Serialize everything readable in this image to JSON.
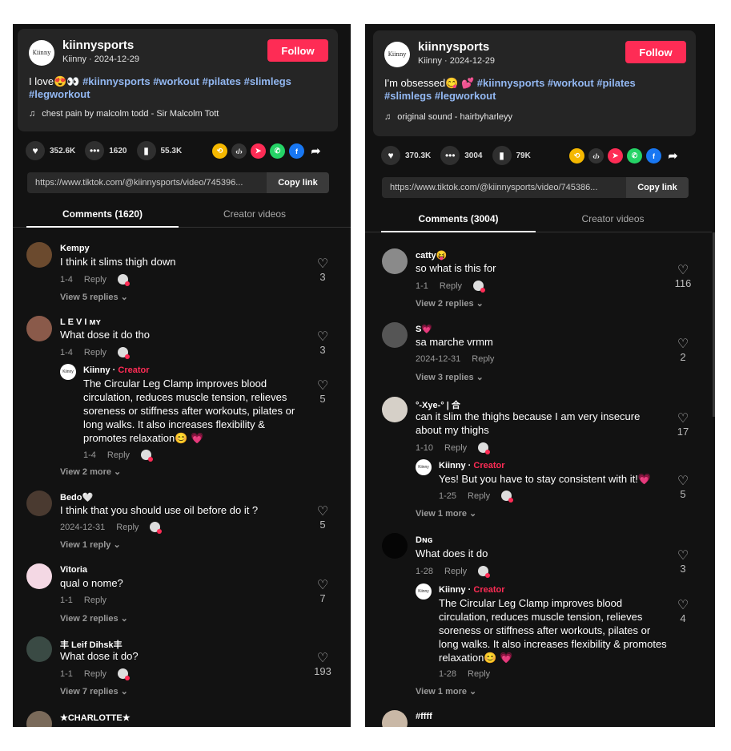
{
  "left": {
    "username": "kiinnysports",
    "nickname": "Kiinny",
    "date": "2024-12-29",
    "logo_text": "Kiinny",
    "follow": "Follow",
    "caption_text": "I love😍👀 ",
    "caption_tags": "#kiinnysports #workout #pilates #slimlegs #legworkout",
    "sound": "chest pain by malcolm todd - Sir Malcolm Tott",
    "likes": "352.6K",
    "comments": "1620",
    "saves": "55.3K",
    "url": "https://www.tiktok.com/@kiinnysports/video/745396...",
    "copy": "Copy link",
    "tab_comments": "Comments (1620)",
    "tab_creator": "Creator videos",
    "c1": {
      "name": "Kempy",
      "text": "I think it slims thigh down",
      "date": "1-4",
      "reply": "Reply",
      "likes": "3",
      "views": "View 5 replies ⌄"
    },
    "c2": {
      "name": "L E V I ᴍʏ",
      "text": "What dose it do tho",
      "date": "1-4",
      "reply": "Reply",
      "likes": "3"
    },
    "r2": {
      "name": "Kiinny · ",
      "badge": "Creator",
      "text": "The Circular Leg Clamp improves blood circulation, reduces muscle tension, relieves soreness or stiffness after workouts, pilates or long walks. It also increases flexibility & promotes relaxation😊 💗",
      "date": "1-4",
      "reply": "Reply",
      "likes": "5",
      "views": "View 2 more ⌄"
    },
    "c3": {
      "name": "Bedo🤍",
      "text": "I think that you should use oil before do it ?",
      "date": "2024-12-31",
      "reply": "Reply",
      "likes": "5",
      "views": "View 1 reply ⌄"
    },
    "c4": {
      "name": "Vitoria",
      "text": "qual o nome?",
      "date": "1-1",
      "reply": "Reply",
      "likes": "7",
      "views": "View 2 replies ⌄"
    },
    "c5": {
      "name": "丰 Leif Dihsk丰",
      "text": "What dose it do?",
      "date": "1-1",
      "reply": "Reply",
      "likes": "193",
      "views": "View 7 replies ⌄"
    },
    "c6": {
      "name": "★CHARLOTTE★"
    }
  },
  "right": {
    "username": "kiinnysports",
    "nickname": "Kiinny",
    "date": "2024-12-29",
    "logo_text": "Kiinny",
    "follow": "Follow",
    "caption_text": "I'm obsessed😋 💕 ",
    "caption_tags": "#kiinnysports #workout #pilates #slimlegs #legworkout",
    "sound": "original sound - hairbyharleyy",
    "likes": "370.3K",
    "comments": "3004",
    "saves": "79K",
    "url": "https://www.tiktok.com/@kiinnysports/video/745386...",
    "copy": "Copy link",
    "tab_comments": "Comments (3004)",
    "tab_creator": "Creator videos",
    "c1": {
      "name": "catty😝",
      "text": "so what is this for",
      "date": "1-1",
      "reply": "Reply",
      "likes": "116",
      "views": "View 2 replies ⌄"
    },
    "c2": {
      "name": "S💗",
      "text": "sa marche vrmm",
      "date": "2024-12-31",
      "reply": "Reply",
      "likes": "2",
      "views": "View 3 replies ⌄"
    },
    "c3": {
      "name": "°-Xye-° | 合",
      "text": "can it slim the thighs because I am very insecure about my thighs",
      "date": "1-10",
      "reply": "Reply",
      "likes": "17"
    },
    "r3": {
      "name": "Kiinny · ",
      "badge": "Creator",
      "text": "Yes! But you have to stay consistent with it!💗",
      "date": "1-25",
      "reply": "Reply",
      "likes": "5",
      "views": "View 1 more ⌄"
    },
    "c4": {
      "name": "Dɴɢ",
      "text": "What does it do",
      "date": "1-28",
      "reply": "Reply",
      "likes": "3"
    },
    "r4": {
      "name": "Kiinny · ",
      "badge": "Creator",
      "text": "The Circular Leg Clamp improves blood circulation, reduces muscle tension, relieves soreness or stiffness after workouts, pilates or long walks. It also increases flexibility & promotes relaxation😊 💗",
      "date": "1-28",
      "reply": "Reply",
      "likes": "4",
      "views": "View 1 more ⌄"
    },
    "c5": {
      "name": "#ffff"
    }
  },
  "colors": {
    "accent": "#fe2c55",
    "tag": "#93b8f2",
    "bg": "#121212",
    "card": "#252525"
  }
}
